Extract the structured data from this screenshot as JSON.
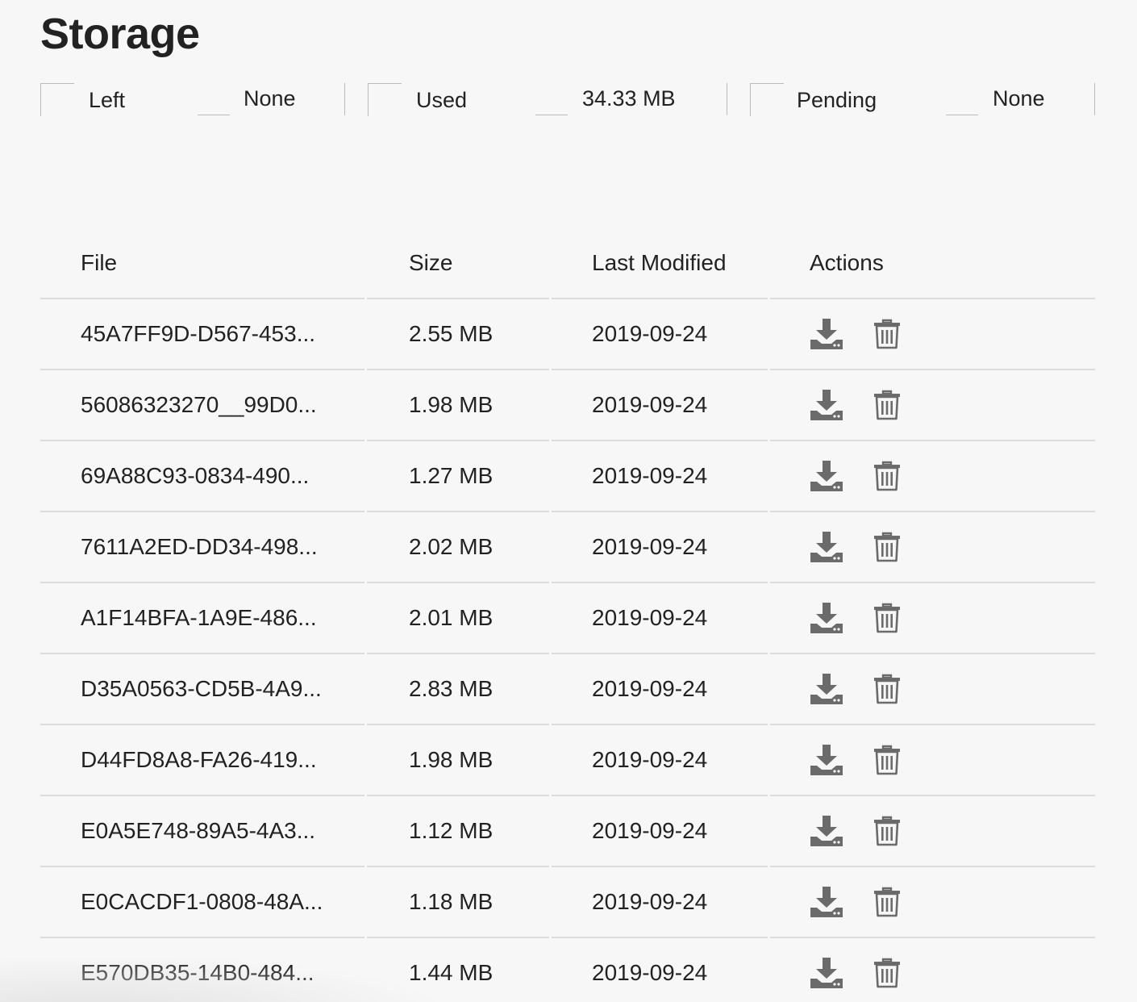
{
  "page": {
    "title": "Storage"
  },
  "stats": [
    {
      "label": "Left",
      "value": "None"
    },
    {
      "label": "Used",
      "value": "34.33 MB"
    },
    {
      "label": "Pending",
      "value": "None"
    }
  ],
  "table": {
    "headers": {
      "file": "File",
      "size": "Size",
      "modified": "Last Modified",
      "actions": "Actions"
    },
    "rows": [
      {
        "file": "45A7FF9D-D567-453...",
        "size": "2.55 MB",
        "modified": "2019-09-24"
      },
      {
        "file": "56086323270__99D0...",
        "size": "1.98 MB",
        "modified": "2019-09-24"
      },
      {
        "file": "69A88C93-0834-490...",
        "size": "1.27 MB",
        "modified": "2019-09-24"
      },
      {
        "file": "7611A2ED-DD34-498...",
        "size": "2.02 MB",
        "modified": "2019-09-24"
      },
      {
        "file": "A1F14BFA-1A9E-486...",
        "size": "2.01 MB",
        "modified": "2019-09-24"
      },
      {
        "file": "D35A0563-CD5B-4A9...",
        "size": "2.83 MB",
        "modified": "2019-09-24"
      },
      {
        "file": "D44FD8A8-FA26-419...",
        "size": "1.98 MB",
        "modified": "2019-09-24"
      },
      {
        "file": "E0A5E748-89A5-4A3...",
        "size": "1.12 MB",
        "modified": "2019-09-24"
      },
      {
        "file": "E0CACDF1-0808-48A...",
        "size": "1.18 MB",
        "modified": "2019-09-24"
      },
      {
        "file": "E570DB35-14B0-484...",
        "size": "1.44 MB",
        "modified": "2019-09-24"
      }
    ]
  },
  "icons": {
    "download": "download-icon",
    "delete": "trash-icon",
    "color": "#6b6b6b"
  }
}
